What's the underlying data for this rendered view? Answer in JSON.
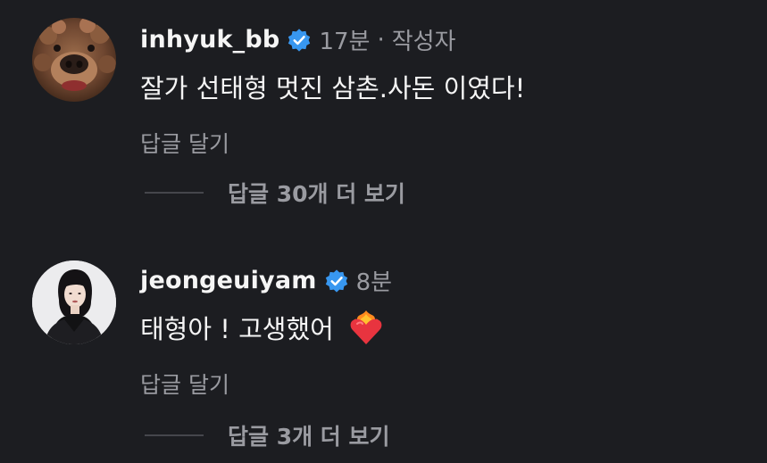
{
  "comments": [
    {
      "username": "inhyuk_bb",
      "time": "17분",
      "separator": "·",
      "author_badge": "작성자",
      "text": "잘가 선태형 멋진 삼촌.사돈 이였다!",
      "reply_label": "답글 달기",
      "more_replies_label": "답글 30개 더 보기",
      "avatar": "dog-avatar"
    },
    {
      "username": "jeongeuiyam",
      "time": "8분",
      "text": "태형아 ! 고생했어",
      "emoji": "heart-on-fire-emoji",
      "reply_label": "답글 달기",
      "more_replies_label": "답글 3개 더 보기",
      "avatar": "woman-avatar"
    }
  ],
  "colors": {
    "background": "#1c1d21",
    "primary_text": "#f5f5f5",
    "secondary_text": "#9a9ba1",
    "verified_blue": "#3897f0"
  }
}
